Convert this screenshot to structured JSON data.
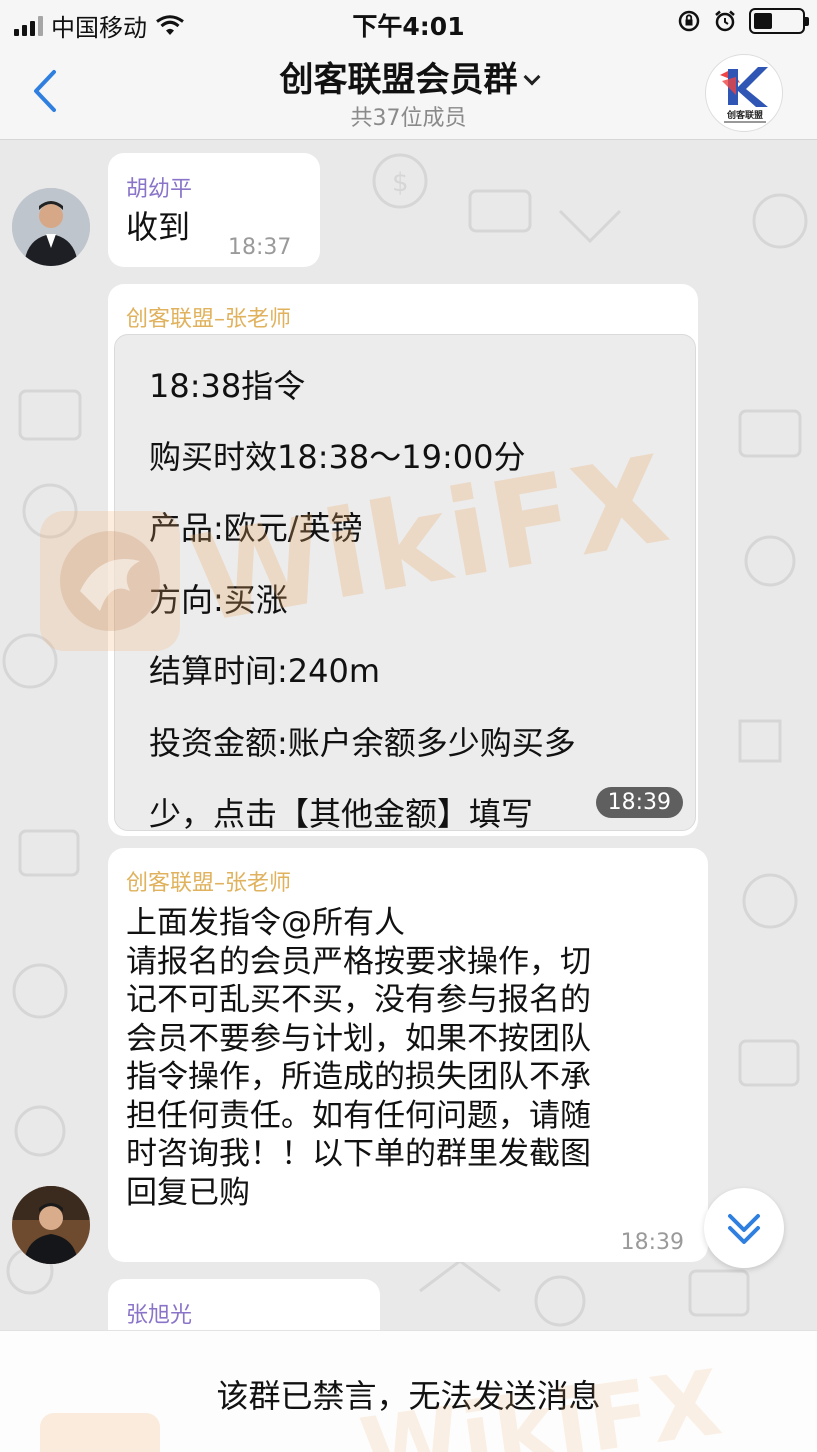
{
  "status_bar": {
    "carrier": "中国移动",
    "time": "下午4:01"
  },
  "nav": {
    "title": "创客联盟会员群",
    "subtitle": "共37位成员",
    "group_logo_text": "创客联盟"
  },
  "messages": [
    {
      "sender": "胡幼平",
      "text": "收到",
      "time": "18:37"
    },
    {
      "sender": "创客联盟–张老师",
      "lines": [
        "18:38指令",
        "购买时效18:38～19:00分",
        "产品:欧元/英镑",
        "方向:买涨",
        "结算时间:240m",
        "投资金额:账户余额多少购买多",
        "少，点击【其他金额】填写"
      ],
      "time": "18:39"
    },
    {
      "sender": "创客联盟–张老师",
      "lines": [
        "上面发指令@所有人",
        "请报名的会员严格按要求操作，切",
        "记不可乱买不买，没有参与报名的",
        "会员不要参与计划，如果不按团队",
        "指令操作，所造成的损失团队不承",
        "担任何责任。如有任何问题，请随",
        "时咨询我！！以下单的群里发截图",
        "回复已购"
      ],
      "time": "18:39"
    },
    {
      "sender": "张旭光"
    }
  ],
  "watermark": "WikiFX",
  "bottom": {
    "muted_notice": "该群已禁言，无法发送消息"
  },
  "colors": {
    "sender_purple": "#8a74c9",
    "sender_gold": "#e0b25d",
    "back_blue": "#2f7fe0"
  }
}
